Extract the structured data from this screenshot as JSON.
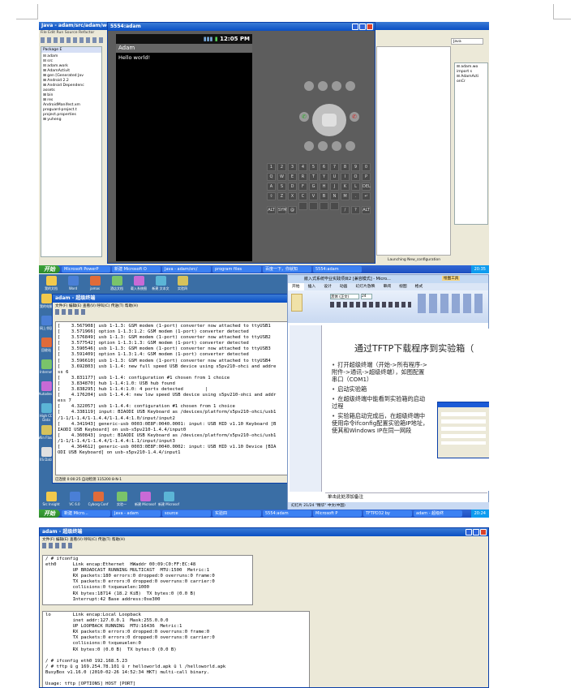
{
  "eclipse": {
    "title": "Java - adam/src/adam/wo",
    "menu": "File  Edit  Run  Source  Refactor",
    "package_tab": "Package E",
    "tree": [
      "⊟ adam",
      "  ⊟ src",
      "    ⊟ adam.work",
      "      ⊞ AdamActivit",
      "  ⊞ gen [Generated Jav",
      "  ⊞ Android 2.2",
      "  ⊞ Android Dependenc",
      "    assets",
      "  ⊞ bin",
      "  ⊞ res",
      "    AndroidManifest.xm",
      "    proguard-project.t",
      "    project.properties",
      "⊞ yuheng"
    ],
    "outline": [
      "⊟ adam.wo",
      "  import s",
      "⊟ AdamActi",
      "    onCr"
    ],
    "java_label": "Java",
    "status": "Launching New_configuration"
  },
  "emulator": {
    "title": "5554:adam",
    "clock": "12:05 PM",
    "app_title": "Adam",
    "content": "Hello world!",
    "keyrows": [
      [
        "1",
        "2",
        "3",
        "4",
        "5",
        "6",
        "7",
        "8",
        "9",
        "0"
      ],
      [
        "Q",
        "W",
        "E",
        "R",
        "T",
        "Y",
        "U",
        "I",
        "O",
        "P"
      ],
      [
        "A",
        "S",
        "D",
        "F",
        "G",
        "H",
        "J",
        "K",
        "L",
        "DEL"
      ],
      [
        "⇧",
        "Z",
        "X",
        "C",
        "V",
        "B",
        "N",
        "M",
        ".",
        "↵"
      ],
      [
        "ALT",
        "SYM",
        "@",
        "",
        "",
        "",
        "",
        "/",
        "?",
        "ALT"
      ]
    ]
  },
  "taskbar1": {
    "start": "开始",
    "tasks": [
      "Microsoft PowerP",
      "新建 Microsoft O",
      "Java - adam/src/",
      "program files",
      "百度一下，你就知",
      "5554:adam"
    ],
    "tray": "20:35"
  },
  "desktop": {
    "icons_top": [
      "我的文档",
      "Word",
      "jamas",
      "酒店文档",
      "载入系统图",
      "新建 文本文",
      "实验四"
    ],
    "icons_left": [
      "我的电脑",
      "网上邻居",
      "回收站",
      "Internet",
      "Autodesk",
      "High CD Data",
      "Win Flash",
      "IIS Data"
    ],
    "icons_bottom": [
      "Src Insight",
      "VC 6.0",
      "Cyborg Conf",
      "实验一",
      "新建 Microsof",
      "新建 Microsof"
    ]
  },
  "term1": {
    "title": "adam - 超级终端",
    "menu": "文件(F)  编辑(E)  查看(V)  呼叫(C)  传送(T)  帮助(H)",
    "lines": [
      "[    3.567908] usb 1-1.3: GSM modem (1-port) converter now attached to ttyUSB1",
      "[    3.571966] option 1-1.3:1.2: GSM modem (1-port) converter detected",
      "[    3.576849] usb 1-1.3: GSM modem (1-port) converter now attached to ttyUSB2",
      "[    3.577542] option 1-1.3:1.3: GSM modem (1-port) converter detected",
      "[    3.590546] usb 1-1.3: GSM modem (1-port) converter now attached to ttyUSB3",
      "[    3.591409] option 1-1.3:1.4: GSM modem (1-port) converter detected",
      "[    3.596610] usb 1-1.3: GSM modem (1-port) converter now attached to ttyUSB4",
      "[    3.692803] usb 1-1.4: new full speed USB device using s5pv210-ohci and addre",
      "ss 6",
      "[    3.831177] usb 1-1.4: configuration #1 chosen from 1 choice",
      "[    3.834870] hub 1-1.4:1.0: USB hub found",
      "[    3.838295] hub 1-1.4:1.0: 4 ports detected        |",
      "[    4.176204] usb 1-1.4.4: new low speed USB device using s5pv210-ohci and addr",
      "ess 7",
      "[    4.322057] usb 1-1.4.4: configuration #1 chosen from 1 choice",
      "[    4.338119] input: BIAODI USB Keyboard as /devices/platform/s5pv210-ohci/usb1",
      "/1-1/1-1.4/1-1.4.4/1-1.4.4:1.0/input/input2",
      "[    4.341943] generic-usb 0003:0E8F:0040.0001: input: USB HID v1.10 Keyboard [B",
      "IAODI USB Keyboard] on usb-s5pv210-1.4.4/input0",
      "[    4.360843] input: BIAODI USB Keyboard as /devices/platform/s5pv210-ohci/usb1",
      "/1-1/1-1.4/1-1.4.4/1-1.4.4:1.1/input/input3",
      "[    4.364612] generic-usb 0003:0E8F:0040.0002: input: USB HID v1.10 Device [BIA",
      "ODI USB Keyboard] on usb-s5pv210-1.4.4/input1"
    ],
    "status": "已连接 0:00:25  自动检测   115200 8-N-1"
  },
  "ppt": {
    "title": "嵌入式系统毕业实践项目2 [兼容模式] - Micro...",
    "tabs": [
      "开始",
      "插入",
      "设计",
      "动画",
      "幻灯片放映",
      "审阅",
      "视图",
      "格式"
    ],
    "tool_tab": "绘图工具",
    "font": "黑体 (正文)",
    "size": "24",
    "slide_title": "通过TFTP下载程序到实验箱（",
    "bullets": [
      "打开超级终端（开始->所有程序->附件->通讯->超级终端），如图配置串口（COM1）",
      "启动实验箱",
      "在超级终端中能看到实验箱的启动过程",
      "实验箱启动完成后，在超级终端中使用命令ifconfig配置实验箱IP地址，使其和Windows IP在同一网段"
    ],
    "notes": "单击此处添加备注",
    "status": "幻灯片 21/24   \"精华\"   中文(中国)"
  },
  "taskbar2": {
    "start": "开始",
    "tasks": [
      "新建 Micro...",
      "Java - adam",
      "source",
      "实验四",
      "5554:adam",
      "Microsoft P",
      "TFTPD32 by",
      "adam - 超级终"
    ],
    "tray": "20:24"
  },
  "term2": {
    "title": "adam - 超级终端",
    "menu": "文件(F)  编辑(E)  查看(V)  呼叫(C)  传送(T)  帮助(H)",
    "lines_a": [
      "/ # ifconfig",
      "eth0      Link encap:Ethernet  HWaddr 00:09:C0:FF:EC:48",
      "          UP BROADCAST RUNNING MULTICAST  MTU:1500  Metric:1",
      "          RX packets:180 errors:0 dropped:0 overruns:0 frame:0",
      "          TX packets:0 errors:0 dropped:0 overruns:0 carrier:0",
      "          collisions:0 txqueuelen:1000",
      "          RX bytes:18714 (18.2 KiB)  TX bytes:0 (0.0 B)",
      "          Interrupt:42 Base address:0xe300"
    ],
    "lines_b": [
      "lo        Link encap:Local Loopback",
      "          inet addr:127.0.0.1  Mask:255.0.0.0",
      "          UP LOOPBACK RUNNING  MTU:16436  Metric:1",
      "          RX packets:0 errors:0 dropped:0 overruns:0 frame:0",
      "          TX packets:0 errors:0 dropped:0 overruns:0 carrier:0",
      "          collisions:0 txqueuelen:0",
      "          RX bytes:0 (0.0 B)  TX bytes:0 (0.0 B)",
      "",
      "/ # ifconfig eth0 192.168.5.23",
      "/ # tftp û g 169.254.78.101 û r helloworld.apk û l /helloworld.apk",
      "BusyBox v1.16.0 (2010-02-26 14:52:34 HKT) multi-call binary.",
      "",
      "Usage: tftp [OPTIONS] HOST [PORT]"
    ]
  }
}
